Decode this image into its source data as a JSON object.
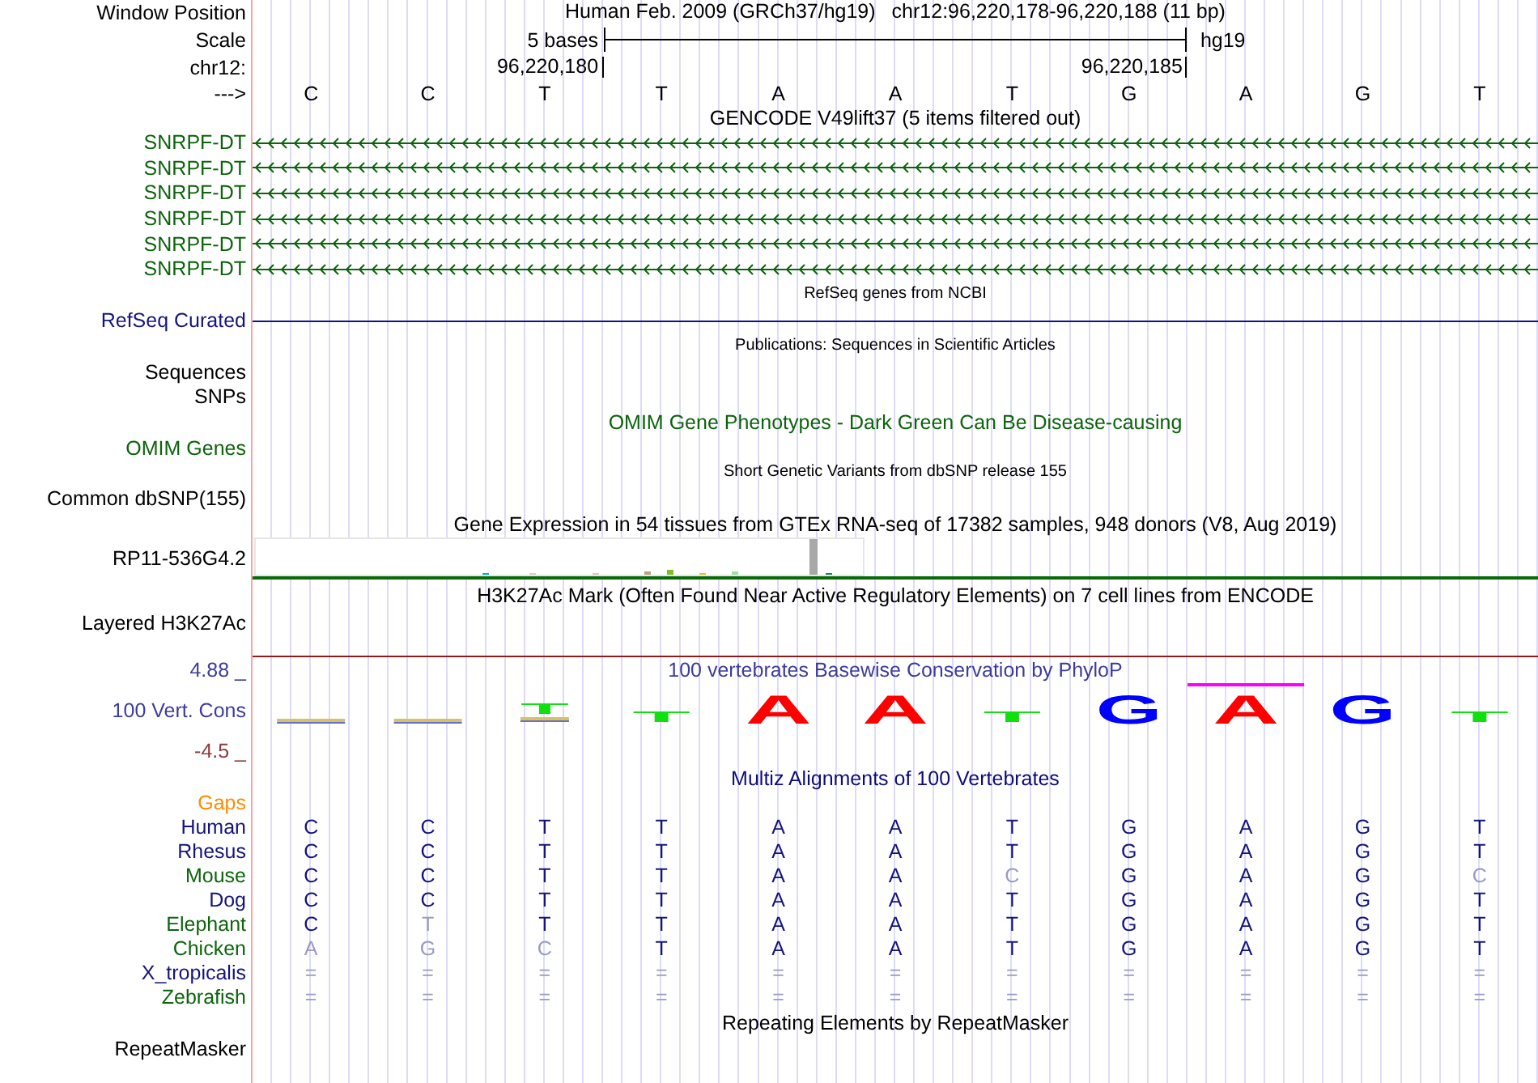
{
  "position": {
    "label": "Window Position",
    "assembly": "Human Feb. 2009 (GRCh37/hg19)",
    "range": "chr12:96,220,178-96,220,188 (11 bp)"
  },
  "scale": {
    "label": "Scale",
    "span": "5 bases",
    "db": "hg19"
  },
  "coordinates": {
    "label": "chr12:",
    "ticks": [
      "96,220,180",
      "96,220,185"
    ]
  },
  "sequence": {
    "label": "--->",
    "bases": [
      "C",
      "C",
      "T",
      "T",
      "A",
      "A",
      "T",
      "G",
      "A",
      "G",
      "T"
    ]
  },
  "tracks": [
    {
      "kind": "genes",
      "title": {
        "text": "GENCODE V49lift37 (5 items filtered out)",
        "color": "#000000"
      },
      "color": "#0c640c",
      "items": [
        {
          "label": "SNRPF-DT"
        },
        {
          "label": "SNRPF-DT"
        },
        {
          "label": "SNRPF-DT"
        },
        {
          "label": "SNRPF-DT"
        },
        {
          "label": "SNRPF-DT"
        },
        {
          "label": "SNRPF-DT"
        }
      ]
    },
    {
      "kind": "gene-line",
      "title": {
        "text": "RefSeq genes from NCBI",
        "color": "#000000"
      },
      "color": "#141480",
      "labels": [
        "RefSeq Curated"
      ]
    },
    {
      "kind": "features",
      "title": {
        "text": "Publications: Sequences in Scientific Articles",
        "color": "#000000"
      },
      "color": "#000000",
      "labels": [
        "Sequences",
        "SNPs"
      ]
    },
    {
      "kind": "empty",
      "title": {
        "text": "OMIM Gene Phenotypes - Dark Green Can Be Disease-causing",
        "color": "#0c640c"
      },
      "color": "#0c640c",
      "labels": [
        "OMIM Genes"
      ]
    },
    {
      "kind": "features",
      "title": {
        "text": "Short Genetic Variants from dbSNP release 155",
        "color": "#000000"
      },
      "color": "#000000",
      "labels": [
        "Common dbSNP(155)"
      ]
    },
    {
      "kind": "expression",
      "title": {
        "text": "Gene Expression in 54 tissues from GTEx RNA-seq of 17382 samples, 948 donors (V8, Aug 2019)",
        "color": "#000000"
      },
      "color": "#000000",
      "labels": [
        "RP11-536G4.2"
      ]
    },
    {
      "kind": "signal",
      "title": {
        "text": "H3K27Ac Mark (Often Found Near Active Regulatory Elements) on 7 cell lines from ENCODE",
        "color": "#000000"
      },
      "color": "#000000",
      "labels": [
        "Layered H3K27Ac"
      ]
    },
    {
      "kind": "conservation",
      "title": {
        "text": "100 vertebrates Basewise Conservation by PhyloP",
        "color": "#3c3c9c"
      },
      "color": "#3c3c9c",
      "labels": [
        "100 Vert. Cons"
      ],
      "axis_max": "4.88 _",
      "axis_min": "-4.5 _",
      "logo": [
        {
          "kind": "smear",
          "clipped": false
        },
        {
          "kind": "smear",
          "clipped": false
        },
        {
          "kind": "stacked",
          "letter": "T",
          "color": "#10e010",
          "clipped": false
        },
        {
          "kind": "flat",
          "letter": "T",
          "color": "#10e010",
          "clipped": false
        },
        {
          "kind": "tall",
          "letter": "A",
          "color": "#ff0000",
          "clipped": false
        },
        {
          "kind": "tall",
          "letter": "A",
          "color": "#ff0000",
          "clipped": false
        },
        {
          "kind": "flat",
          "letter": "T",
          "color": "#10e010",
          "clipped": false
        },
        {
          "kind": "tall",
          "letter": "G",
          "color": "#0000ff",
          "clipped": false
        },
        {
          "kind": "tall",
          "letter": "A",
          "color": "#ff0000",
          "clipped": true
        },
        {
          "kind": "tall",
          "letter": "G",
          "color": "#0000ff",
          "clipped": false
        },
        {
          "kind": "flat",
          "letter": "T",
          "color": "#10e010",
          "clipped": false
        }
      ]
    },
    {
      "kind": "alignment",
      "title": {
        "text": "Multiz Alignments of 100 Vertebrates",
        "color": "#0c0c78"
      },
      "gaps_label": "Gaps",
      "species": [
        {
          "name": "Human",
          "color": "#14147c",
          "bases": [
            {
              "base": "C",
              "dimmed": false
            },
            {
              "base": "C",
              "dimmed": false
            },
            {
              "base": "T",
              "dimmed": false
            },
            {
              "base": "T",
              "dimmed": false
            },
            {
              "base": "A",
              "dimmed": false
            },
            {
              "base": "A",
              "dimmed": false
            },
            {
              "base": "T",
              "dimmed": false
            },
            {
              "base": "G",
              "dimmed": false
            },
            {
              "base": "A",
              "dimmed": false
            },
            {
              "base": "G",
              "dimmed": false
            },
            {
              "base": "T",
              "dimmed": false
            }
          ]
        },
        {
          "name": "Rhesus",
          "color": "#14147c",
          "bases": [
            {
              "base": "C",
              "dimmed": false
            },
            {
              "base": "C",
              "dimmed": false
            },
            {
              "base": "T",
              "dimmed": false
            },
            {
              "base": "T",
              "dimmed": false
            },
            {
              "base": "A",
              "dimmed": false
            },
            {
              "base": "A",
              "dimmed": false
            },
            {
              "base": "T",
              "dimmed": false
            },
            {
              "base": "G",
              "dimmed": false
            },
            {
              "base": "A",
              "dimmed": false
            },
            {
              "base": "G",
              "dimmed": false
            },
            {
              "base": "T",
              "dimmed": false
            }
          ]
        },
        {
          "name": "Mouse",
          "color": "#0c640c",
          "bases": [
            {
              "base": "C",
              "dimmed": false
            },
            {
              "base": "C",
              "dimmed": false
            },
            {
              "base": "T",
              "dimmed": false
            },
            {
              "base": "T",
              "dimmed": false
            },
            {
              "base": "A",
              "dimmed": false
            },
            {
              "base": "A",
              "dimmed": false
            },
            {
              "base": "C",
              "dimmed": true
            },
            {
              "base": "G",
              "dimmed": false
            },
            {
              "base": "A",
              "dimmed": false
            },
            {
              "base": "G",
              "dimmed": false
            },
            {
              "base": "C",
              "dimmed": true
            }
          ]
        },
        {
          "name": "Dog",
          "color": "#14147c",
          "bases": [
            {
              "base": "C",
              "dimmed": false
            },
            {
              "base": "C",
              "dimmed": false
            },
            {
              "base": "T",
              "dimmed": false
            },
            {
              "base": "T",
              "dimmed": false
            },
            {
              "base": "A",
              "dimmed": false
            },
            {
              "base": "A",
              "dimmed": false
            },
            {
              "base": "T",
              "dimmed": false
            },
            {
              "base": "G",
              "dimmed": false
            },
            {
              "base": "A",
              "dimmed": false
            },
            {
              "base": "G",
              "dimmed": false
            },
            {
              "base": "T",
              "dimmed": false
            }
          ]
        },
        {
          "name": "Elephant",
          "color": "#0c640c",
          "bases": [
            {
              "base": "C",
              "dimmed": false
            },
            {
              "base": "T",
              "dimmed": true
            },
            {
              "base": "T",
              "dimmed": false
            },
            {
              "base": "T",
              "dimmed": false
            },
            {
              "base": "A",
              "dimmed": false
            },
            {
              "base": "A",
              "dimmed": false
            },
            {
              "base": "T",
              "dimmed": false
            },
            {
              "base": "G",
              "dimmed": false
            },
            {
              "base": "A",
              "dimmed": false
            },
            {
              "base": "G",
              "dimmed": false
            },
            {
              "base": "T",
              "dimmed": false
            }
          ]
        },
        {
          "name": "Chicken",
          "color": "#0c640c",
          "bases": [
            {
              "base": "A",
              "dimmed": true
            },
            {
              "base": "G",
              "dimmed": true
            },
            {
              "base": "C",
              "dimmed": true
            },
            {
              "base": "T",
              "dimmed": false
            },
            {
              "base": "A",
              "dimmed": false
            },
            {
              "base": "A",
              "dimmed": false
            },
            {
              "base": "T",
              "dimmed": false
            },
            {
              "base": "G",
              "dimmed": false
            },
            {
              "base": "A",
              "dimmed": false
            },
            {
              "base": "G",
              "dimmed": false
            },
            {
              "base": "T",
              "dimmed": false
            }
          ]
        },
        {
          "name": "X_tropicalis",
          "color": "#14147c",
          "bases": [
            {
              "base": "=",
              "dimmed": true
            },
            {
              "base": "=",
              "dimmed": true
            },
            {
              "base": "=",
              "dimmed": true
            },
            {
              "base": "=",
              "dimmed": true
            },
            {
              "base": "=",
              "dimmed": true
            },
            {
              "base": "=",
              "dimmed": true
            },
            {
              "base": "=",
              "dimmed": true
            },
            {
              "base": "=",
              "dimmed": true
            },
            {
              "base": "=",
              "dimmed": true
            },
            {
              "base": "=",
              "dimmed": true
            },
            {
              "base": "=",
              "dimmed": true
            }
          ]
        },
        {
          "name": "Zebrafish",
          "color": "#0c640c",
          "bases": [
            {
              "base": "=",
              "dimmed": true
            },
            {
              "base": "=",
              "dimmed": true
            },
            {
              "base": "=",
              "dimmed": true
            },
            {
              "base": "=",
              "dimmed": true
            },
            {
              "base": "=",
              "dimmed": true
            },
            {
              "base": "=",
              "dimmed": true
            },
            {
              "base": "=",
              "dimmed": true
            },
            {
              "base": "=",
              "dimmed": true
            },
            {
              "base": "=",
              "dimmed": true
            },
            {
              "base": "=",
              "dimmed": true
            },
            {
              "base": "=",
              "dimmed": true
            }
          ]
        }
      ]
    },
    {
      "kind": "empty",
      "title": {
        "text": "Repeating Elements by RepeatMasker",
        "color": "#000000"
      },
      "color": "#000000",
      "labels": [
        "RepeatMasker"
      ]
    }
  ]
}
